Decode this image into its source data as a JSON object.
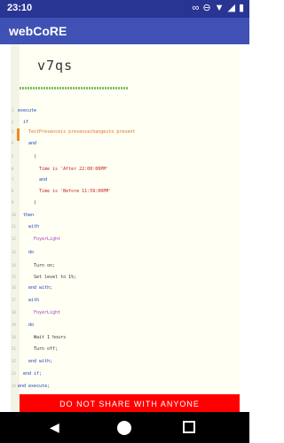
{
  "status_bar": {
    "time": "23:10"
  },
  "app_bar": {
    "title": "webCoRE"
  },
  "header": {
    "text": "v7qs"
  },
  "code": {
    "lines": [
      {
        "text": "execute",
        "cls": "kw"
      },
      {
        "text": "if",
        "cls": "kw"
      },
      {
        "text": "TestPresenceis presencechangesto present",
        "cls": "cond"
      },
      {
        "text": "and",
        "cls": "kw"
      },
      {
        "text": "(",
        "cls": "act"
      },
      {
        "text": "Time is 'After 22:00:00PM'",
        "cls": "str"
      },
      {
        "text": "and",
        "cls": "kw"
      },
      {
        "text": "Time is 'Before 11:59:00PM'",
        "cls": "str"
      },
      {
        "text": ")",
        "cls": "act"
      },
      {
        "text": "then",
        "cls": "kw"
      },
      {
        "text": "with",
        "cls": "kw"
      },
      {
        "text": "FoyerLight",
        "cls": "dev"
      },
      {
        "text": "do",
        "cls": "kw"
      },
      {
        "text": "Turn on;",
        "cls": "act"
      },
      {
        "text": "Set level to 1%;",
        "cls": "act"
      },
      {
        "text": "end with;",
        "cls": "kw"
      },
      {
        "text": "with",
        "cls": "kw"
      },
      {
        "text": "FoyerLight",
        "cls": "dev"
      },
      {
        "text": "do",
        "cls": "kw"
      },
      {
        "text": "Wait 1 hours",
        "cls": "act"
      },
      {
        "text": "Turn off;",
        "cls": "act"
      },
      {
        "text": "end with;",
        "cls": "kw"
      },
      {
        "text": "end if;",
        "cls": "kw"
      },
      {
        "text": "end execute;",
        "cls": "kw"
      }
    ]
  },
  "banner": {
    "text": "DO NOT SHARE WITH ANYONE"
  }
}
